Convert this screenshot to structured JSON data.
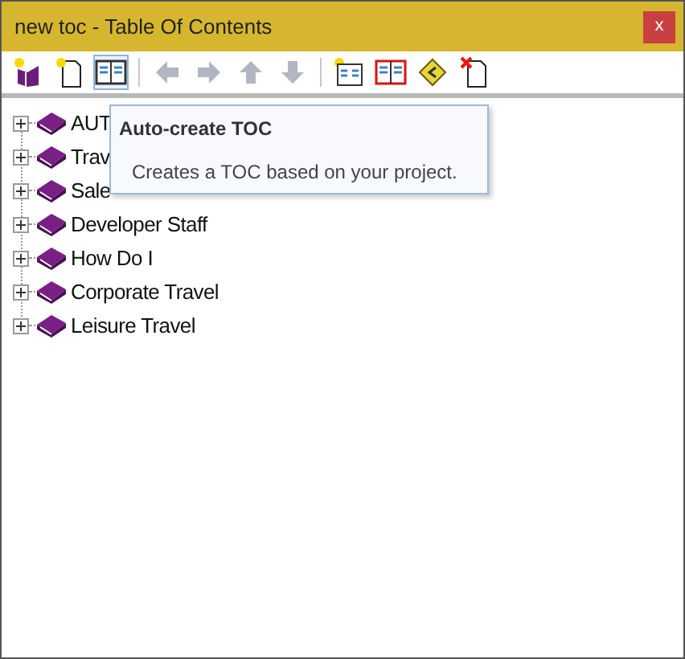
{
  "window": {
    "title": "new toc - Table Of Contents",
    "close": "x"
  },
  "toolbar": [
    {
      "kind": "new-book",
      "disabled": false,
      "selected": false
    },
    {
      "kind": "new-page",
      "disabled": false,
      "selected": false
    },
    {
      "kind": "auto-toc",
      "disabled": false,
      "selected": true
    },
    {
      "kind": "separator"
    },
    {
      "kind": "left",
      "disabled": true,
      "selected": false
    },
    {
      "kind": "right",
      "disabled": true,
      "selected": false
    },
    {
      "kind": "up",
      "disabled": true,
      "selected": false
    },
    {
      "kind": "down",
      "disabled": true,
      "selected": false
    },
    {
      "kind": "separator"
    },
    {
      "kind": "link-book",
      "disabled": false,
      "selected": false
    },
    {
      "kind": "red-book",
      "disabled": false,
      "selected": false
    },
    {
      "kind": "diamond",
      "disabled": false,
      "selected": false
    },
    {
      "kind": "delete",
      "disabled": false,
      "selected": false
    }
  ],
  "tree": [
    {
      "label": "AUT",
      "expanded": false
    },
    {
      "label": "Trav",
      "expanded": false
    },
    {
      "label": "Sale",
      "expanded": false
    },
    {
      "label": "Developer Staff",
      "expanded": false
    },
    {
      "label": "How Do I",
      "expanded": false
    },
    {
      "label": "Corporate Travel",
      "expanded": false
    },
    {
      "label": "Leisure Travel",
      "expanded": false
    }
  ],
  "tooltip": {
    "title": "Auto-create TOC",
    "text": "Creates a TOC based on your project."
  }
}
